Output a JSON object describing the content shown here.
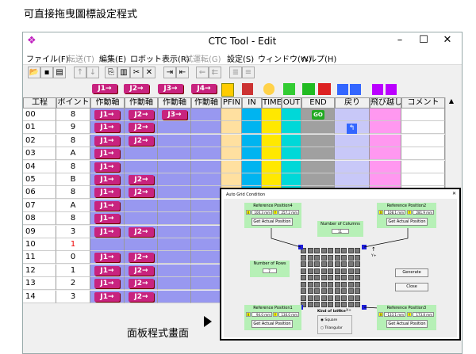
{
  "captions": {
    "top": "可直接拖曳圖標設定程式",
    "bottom": "面板程式畫面"
  },
  "window": {
    "title": "CTC Tool - Edit",
    "minimize": "–",
    "maximize": "☐",
    "close": "✕"
  },
  "menu": [
    {
      "label": "ファイル(F)",
      "enabled": true
    },
    {
      "label": "転送(T)",
      "enabled": false
    },
    {
      "label": "編集(E)",
      "enabled": true
    },
    {
      "label": "ロボット表示(R)",
      "enabled": true
    },
    {
      "label": "試運転(G)",
      "enabled": false
    },
    {
      "label": "設定(S)",
      "enabled": true
    },
    {
      "label": "ウィンドウ(W)",
      "enabled": true
    },
    {
      "label": "ヘルプ(H)",
      "enabled": true
    }
  ],
  "toolbar_icons": [
    "open-icon",
    "save-icon",
    "print-icon",
    "up-icon",
    "down-icon",
    "copy-icon",
    "paste-icon",
    "cut-icon",
    "delete-icon",
    "insert-row-icon",
    "insert-col-icon",
    "indent-icon",
    "outdent-icon",
    "align-left-icon",
    "align-right-icon"
  ],
  "header_icons": {
    "j1": "J1→",
    "j2": "J2→",
    "j3": "J3→",
    "j4": "J4→"
  },
  "columns": [
    "工程",
    "ポイント",
    "作動軸",
    "作動軸",
    "作動軸",
    "作動軸",
    "PFIN",
    "IN",
    "TIME",
    "OUT",
    "END",
    "戻り",
    "飛び越し",
    "コメント"
  ],
  "column_colors": {
    "axis": "#9898f0",
    "pfin": "#ffe0a0",
    "in": "#00b4f0",
    "time": "#ffe800",
    "out": "#00d8d8",
    "end": "#a0a0a0",
    "modori": "#c8c8f8",
    "tobikoshi": "#ff98f0",
    "comment": "#ffffff"
  },
  "rows": [
    {
      "step": "00",
      "point": "8",
      "axes": [
        "J1",
        "J2",
        "J3"
      ]
    },
    {
      "step": "01",
      "point": "9",
      "axes": [
        "J1",
        "J2"
      ]
    },
    {
      "step": "02",
      "point": "8",
      "axes": [
        "J1",
        "J2"
      ]
    },
    {
      "step": "03",
      "point": "A",
      "axes": [
        "J1"
      ]
    },
    {
      "step": "04",
      "point": "8",
      "axes": [
        "J1"
      ]
    },
    {
      "step": "05",
      "point": "B",
      "axes": [
        "J1",
        "J2"
      ]
    },
    {
      "step": "06",
      "point": "8",
      "axes": [
        "J1",
        "J2"
      ]
    },
    {
      "step": "07",
      "point": "A",
      "axes": [
        "J1"
      ]
    },
    {
      "step": "08",
      "point": "8",
      "axes": [
        "J1"
      ]
    },
    {
      "step": "09",
      "point": "3",
      "axes": [
        "J1",
        "J2"
      ]
    },
    {
      "step": "10",
      "point": "1",
      "axes": [],
      "highlight": true
    },
    {
      "step": "11",
      "point": "0",
      "axes": [
        "J1",
        "J2"
      ]
    },
    {
      "step": "12",
      "point": "1",
      "axes": [
        "J1",
        "J2"
      ]
    },
    {
      "step": "13",
      "point": "2",
      "axes": [
        "J1",
        "J2"
      ]
    },
    {
      "step": "14",
      "point": "3",
      "axes": [
        "J1",
        "J2"
      ]
    }
  ],
  "end_go_label": "GO",
  "dialog": {
    "title": "Auto Grid Condition",
    "close": "✕",
    "ref4": {
      "title": "Reference Position4",
      "x": "100.3 mm",
      "y": "257.2 mm",
      "button": "Get Actual Position"
    },
    "ref2": {
      "title": "Reference Position2",
      "x": "108.1 mm",
      "y": "281.9 mm",
      "button": "Get Actual Position"
    },
    "ref1": {
      "title": "Reference Position1",
      "x": "94.0 mm",
      "y": "130.0 mm",
      "button": "Get Actual Position"
    },
    "ref3": {
      "title": "Reference Position3",
      "x": "-133.1 mm",
      "y": "173.8 mm",
      "button": "Get Actual Position"
    },
    "num_columns": {
      "label": "Number of Columns",
      "value": "11"
    },
    "num_rows": {
      "label": "Number of Rows",
      "value": "7"
    },
    "lattice": {
      "label": "Kind of lattice",
      "opt1": "Square",
      "opt2": "Triangular"
    },
    "generate": "Generate",
    "close_btn": "Close",
    "axis_x": "X+",
    "axis_y": "Y+",
    "x_label": "X",
    "y_label": "Y"
  }
}
